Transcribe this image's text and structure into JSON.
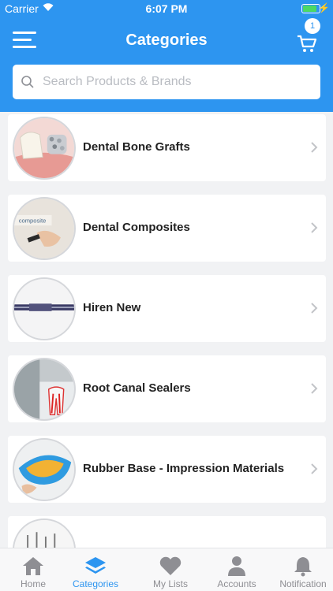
{
  "status_bar": {
    "carrier": "Carrier",
    "time": "6:07 PM",
    "battery_level": 0.85
  },
  "header": {
    "title": "Categories",
    "cart_count": "1",
    "search_placeholder": "Search Products & Brands"
  },
  "categories": [
    {
      "label": "Dental Bone Grafts",
      "image_icon": "dental-bone-graft-photo"
    },
    {
      "label": "Dental Composites",
      "image_icon": "dental-composite-photo"
    },
    {
      "label": "Hiren New",
      "image_icon": "dental-instrument-photo"
    },
    {
      "label": "Root Canal Sealers",
      "image_icon": "root-canal-photo"
    },
    {
      "label": "Rubber Base - Impression Materials",
      "image_icon": "impression-tray-photo"
    },
    {
      "label": "",
      "image_icon": "dental-tools-photo"
    }
  ],
  "tabs": [
    {
      "label": "Home",
      "icon": "home-icon"
    },
    {
      "label": "Categories",
      "icon": "layers-icon",
      "active": true
    },
    {
      "label": "My Lists",
      "icon": "heart-icon"
    },
    {
      "label": "Accounts",
      "icon": "person-icon"
    },
    {
      "label": "Notification",
      "icon": "bell-icon"
    }
  ],
  "colors": {
    "brand": "#2d95f0",
    "inactive_tab": "#8e8e93",
    "background": "#f1f2f4"
  }
}
